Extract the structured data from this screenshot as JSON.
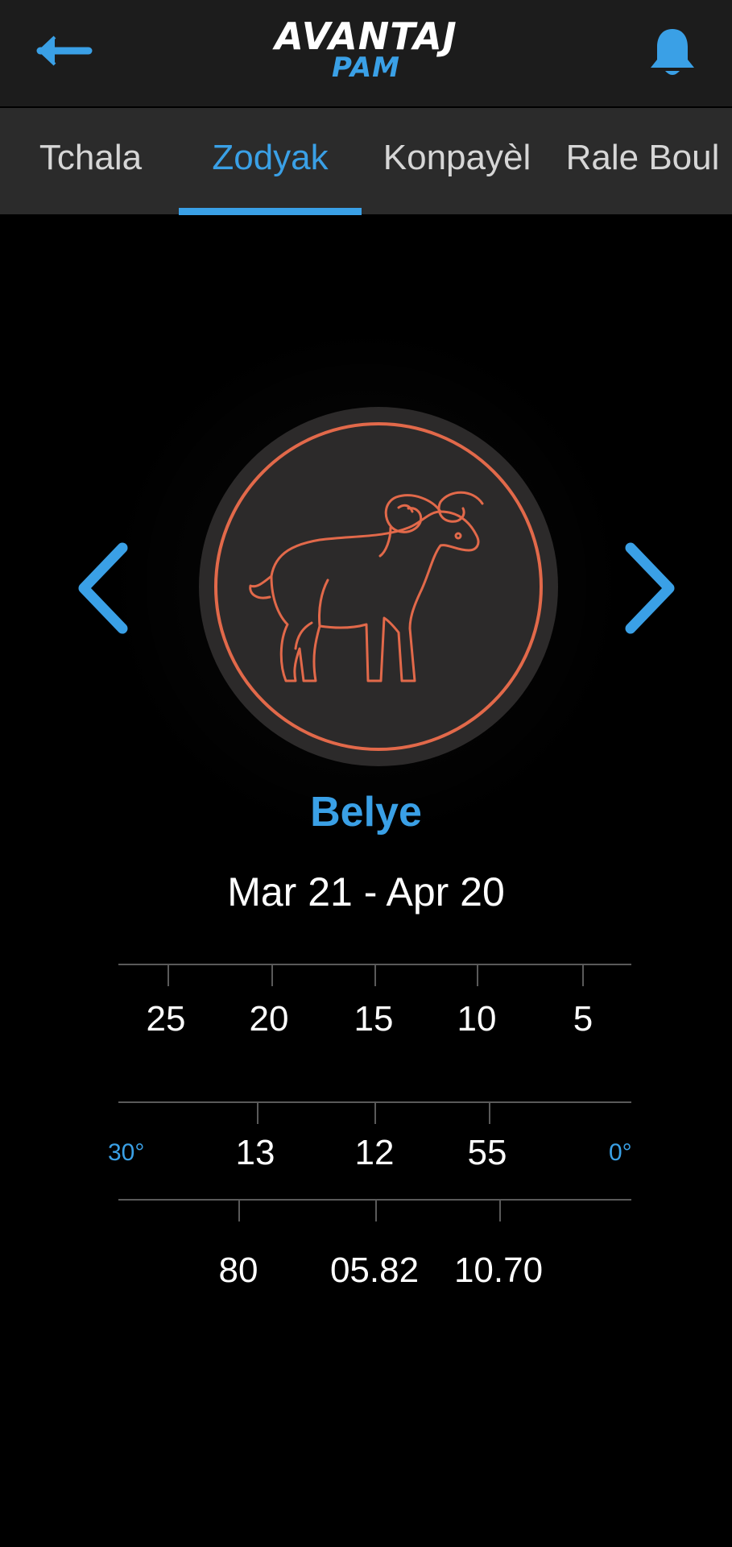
{
  "header": {
    "logo_main": "AVANTAJ",
    "logo_sub": "PAM",
    "back_icon": "arrow-left-icon",
    "notification_icon": "bell-icon",
    "accent_color": "#3aa0e6"
  },
  "tabs": [
    {
      "label": "Tchala",
      "active": false
    },
    {
      "label": "Zodyak",
      "active": true
    },
    {
      "label": "Konpayèl",
      "active": false
    },
    {
      "label": "Rale Boul",
      "active": false
    }
  ],
  "zodiac": {
    "name": "Belye",
    "dates": "Mar 21 - Apr 20",
    "icon": "ram-icon",
    "icon_color": "#e2694a",
    "prev_icon": "chevron-left-icon",
    "next_icon": "chevron-right-icon"
  },
  "scale": {
    "row1": [
      "25",
      "20",
      "15",
      "10",
      "5"
    ],
    "row2_left_degree": "30°",
    "row2": [
      "13",
      "12",
      "55"
    ],
    "row2_right_degree": "0°",
    "row3": [
      "80",
      "05.82",
      "10.70"
    ]
  }
}
